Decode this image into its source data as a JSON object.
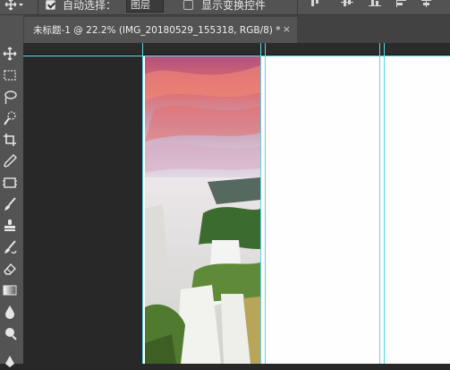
{
  "options": {
    "auto_select_label": "自动选择：",
    "auto_select_checked": true,
    "auto_select_target": "图层",
    "show_transform_label": "显示变换控件",
    "show_transform_checked": false
  },
  "document": {
    "tab_title": "未标题-1 @ 22.2% (IMG_20180529_155318, RGB/8) *",
    "close_glyph": "×"
  },
  "tools": [
    "move-tool",
    "marquee-tool",
    "lasso-tool",
    "quick-select-tool",
    "crop-tool",
    "eyedropper-tool",
    "frame-tool",
    "brush-tool",
    "stamp-tool",
    "history-brush-tool",
    "eraser-tool",
    "gradient-tool",
    "blur-tool",
    "dodge-tool"
  ],
  "colors": {
    "guide": "#5fd6e0",
    "panel": "#535353",
    "workspace": "#282828"
  }
}
